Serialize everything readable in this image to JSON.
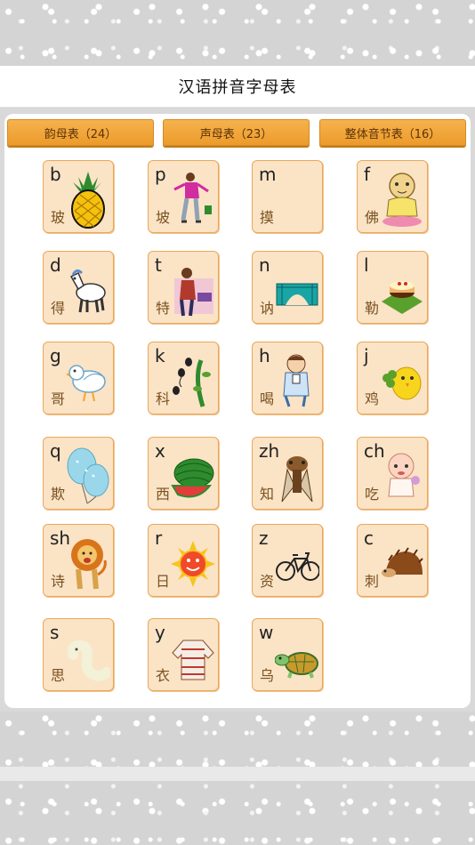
{
  "header": {
    "title": "汉语拼音字母表"
  },
  "tabs": [
    {
      "label": "韵母表（24）"
    },
    {
      "label": "声母表（23）"
    },
    {
      "label": "整体音节表（16）"
    }
  ],
  "initials": [
    {
      "letter": "b",
      "hanzi": "玻",
      "icon": "pineapple"
    },
    {
      "letter": "p",
      "hanzi": "坡",
      "icon": "person-walking"
    },
    {
      "letter": "m",
      "hanzi": "摸",
      "icon": "none"
    },
    {
      "letter": "f",
      "hanzi": "佛",
      "icon": "buddha"
    },
    {
      "letter": "d",
      "hanzi": "得",
      "icon": "horse"
    },
    {
      "letter": "t",
      "hanzi": "特",
      "icon": "woman"
    },
    {
      "letter": "n",
      "hanzi": "讷",
      "icon": "bridge"
    },
    {
      "letter": "l",
      "hanzi": "勒",
      "icon": "cake"
    },
    {
      "letter": "g",
      "hanzi": "哥",
      "icon": "dove"
    },
    {
      "letter": "k",
      "hanzi": "科",
      "icon": "tadpoles"
    },
    {
      "letter": "h",
      "hanzi": "喝",
      "icon": "child-drinking"
    },
    {
      "letter": "j",
      "hanzi": "鸡",
      "icon": "chick"
    },
    {
      "letter": "q",
      "hanzi": "欺",
      "icon": "balloons"
    },
    {
      "letter": "x",
      "hanzi": "西",
      "icon": "watermelon"
    },
    {
      "letter": "zh",
      "hanzi": "知",
      "icon": "cicada"
    },
    {
      "letter": "ch",
      "hanzi": "吃",
      "icon": "baby-eating"
    },
    {
      "letter": "sh",
      "hanzi": "诗",
      "icon": "lion"
    },
    {
      "letter": "r",
      "hanzi": "日",
      "icon": "sun"
    },
    {
      "letter": "z",
      "hanzi": "资",
      "icon": "bicycle"
    },
    {
      "letter": "c",
      "hanzi": "刺",
      "icon": "hedgehog"
    },
    {
      "letter": "s",
      "hanzi": "思",
      "icon": "silkworm"
    },
    {
      "letter": "y",
      "hanzi": "衣",
      "icon": "sweater"
    },
    {
      "letter": "w",
      "hanzi": "乌",
      "icon": "turtle"
    }
  ]
}
